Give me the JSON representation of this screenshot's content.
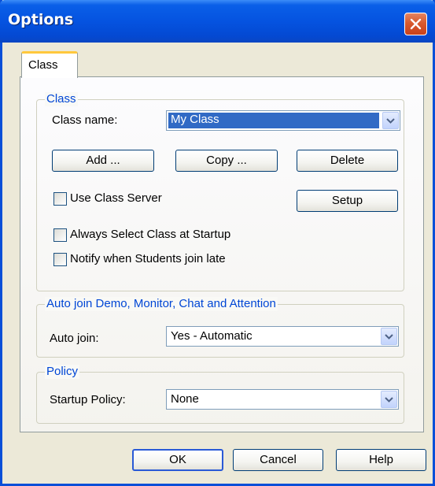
{
  "window": {
    "title": "Options"
  },
  "tabs": [
    {
      "label": "Class"
    }
  ],
  "class_group": {
    "title": "Class",
    "class_name_label": "Class name:",
    "class_name_value": "My Class",
    "add_label": "Add ...",
    "copy_label": "Copy ...",
    "delete_label": "Delete",
    "use_class_server_label": "Use Class Server",
    "use_class_server_checked": false,
    "setup_label": "Setup",
    "always_select_label": "Always Select Class at Startup",
    "always_select_checked": false,
    "notify_label": "Notify when Students join late",
    "notify_checked": false
  },
  "auto_join_group": {
    "title": "Auto join Demo, Monitor, Chat and Attention",
    "label": "Auto join:",
    "value": "Yes - Automatic"
  },
  "policy_group": {
    "title": "Policy",
    "label": "Startup Policy:",
    "value": "None"
  },
  "footer": {
    "ok_label": "OK",
    "cancel_label": "Cancel",
    "help_label": "Help"
  },
  "icons": {
    "close": "close-icon",
    "dropdown": "chevron-down-icon"
  },
  "colors": {
    "title_bar": "#0553e0",
    "group_title": "#0046d5",
    "selection": "#316ac5",
    "close_button": "#d85a2e"
  }
}
